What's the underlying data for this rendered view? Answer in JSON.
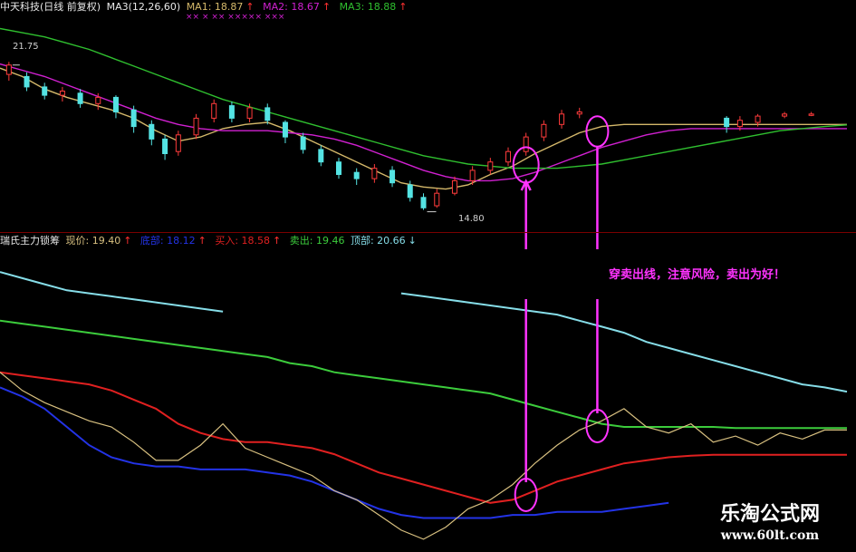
{
  "top_header": {
    "stock": "中天科技(日线 前复权)",
    "ma3_label": "MA3(12,26,60)",
    "ma1_label": "MA1: 18.87",
    "ma2_label": "MA2: 18.67",
    "ma3_value_label": "MA3: 18.88",
    "arrow_up": "↑",
    "markers": "×× × ×× ××××× ×××"
  },
  "bottom_header": {
    "indicator": "瑞氏主力锁筹",
    "price_label": "现价: 19.40",
    "bottom_label": "底部: 18.12",
    "buy_label": "买入: 18.58",
    "sell_label": "卖出: 19.46",
    "top_label": "顶部: 20.66",
    "arrow_up": "↑",
    "arrow_down": "↓"
  },
  "annotation": "穿卖出线，注意风险，卖出为好！",
  "price_high_label": "21.75",
  "price_low_label": "14.80",
  "watermark": {
    "title": "乐淘公式网",
    "url": "www.60lt.com"
  },
  "colors": {
    "background": "#000000",
    "ma1": "#d4b86a",
    "ma2": "#d020d0",
    "ma3": "#2fbf2f",
    "candle_up": "#ff3b3b",
    "candle_down": "#54e3e3",
    "top_line": "#86dde8",
    "sell_line": "#3ccc3c",
    "buy_line": "#e02020",
    "bottom_line": "#2333e6",
    "price_line": "#d8c080",
    "annotation": "#ff33ff"
  },
  "chart_data": [
    {
      "type": "line",
      "title": "中天科技(日线 前复权)",
      "x": [
        0,
        5,
        10,
        15,
        20,
        25,
        30,
        35,
        40,
        45,
        50,
        55,
        60,
        65,
        70,
        75,
        80,
        85,
        90,
        95,
        100,
        105,
        110,
        115,
        120,
        125,
        130,
        135,
        140,
        145,
        150,
        155,
        160,
        165,
        170,
        175,
        180,
        185,
        190
      ],
      "series": [
        {
          "name": "MA1",
          "values": [
            21.6,
            21.2,
            20.6,
            20.2,
            19.9,
            19.6,
            19.2,
            18.6,
            18.1,
            18.3,
            18.7,
            18.9,
            19.0,
            18.6,
            18.1,
            17.6,
            17.1,
            16.6,
            16.1,
            15.9,
            15.8,
            16.0,
            16.5,
            16.9,
            17.5,
            18.0,
            18.5,
            18.8,
            18.9,
            18.9,
            18.9,
            18.9,
            18.9,
            18.9,
            18.9,
            18.9,
            18.9,
            18.9,
            18.9
          ]
        },
        {
          "name": "MA2",
          "values": [
            21.8,
            21.5,
            21.2,
            20.8,
            20.4,
            20.0,
            19.6,
            19.2,
            18.9,
            18.7,
            18.6,
            18.6,
            18.6,
            18.5,
            18.4,
            18.2,
            17.9,
            17.5,
            17.1,
            16.7,
            16.4,
            16.2,
            16.2,
            16.3,
            16.6,
            17.0,
            17.4,
            17.8,
            18.1,
            18.4,
            18.6,
            18.7,
            18.7,
            18.7,
            18.7,
            18.7,
            18.7,
            18.7,
            18.7
          ]
        },
        {
          "name": "MA3",
          "values": [
            23.5,
            23.3,
            23.1,
            22.8,
            22.5,
            22.1,
            21.7,
            21.3,
            20.9,
            20.5,
            20.1,
            19.8,
            19.5,
            19.2,
            18.9,
            18.6,
            18.3,
            18.0,
            17.7,
            17.4,
            17.2,
            17.0,
            16.9,
            16.8,
            16.8,
            16.8,
            16.9,
            17.0,
            17.2,
            17.4,
            17.6,
            17.8,
            18.0,
            18.2,
            18.4,
            18.6,
            18.7,
            18.8,
            18.88
          ]
        }
      ],
      "candles": [
        {
          "x": 2,
          "o": 21.3,
          "c": 21.75,
          "h": 21.9,
          "l": 21.0
        },
        {
          "x": 6,
          "o": 21.2,
          "c": 20.7,
          "h": 21.4,
          "l": 20.5
        },
        {
          "x": 10,
          "o": 20.7,
          "c": 20.3,
          "h": 20.9,
          "l": 20.1
        },
        {
          "x": 14,
          "o": 20.3,
          "c": 20.5,
          "h": 20.7,
          "l": 20.0
        },
        {
          "x": 18,
          "o": 20.4,
          "c": 19.9,
          "h": 20.6,
          "l": 19.7
        },
        {
          "x": 22,
          "o": 19.9,
          "c": 20.2,
          "h": 20.4,
          "l": 19.6
        },
        {
          "x": 26,
          "o": 20.2,
          "c": 19.5,
          "h": 20.3,
          "l": 19.2
        },
        {
          "x": 30,
          "o": 19.6,
          "c": 18.8,
          "h": 19.8,
          "l": 18.5
        },
        {
          "x": 34,
          "o": 18.9,
          "c": 18.2,
          "h": 19.1,
          "l": 17.9
        },
        {
          "x": 37,
          "o": 18.2,
          "c": 17.5,
          "h": 18.4,
          "l": 17.2
        },
        {
          "x": 40,
          "o": 17.6,
          "c": 18.4,
          "h": 18.6,
          "l": 17.4
        },
        {
          "x": 44,
          "o": 18.4,
          "c": 19.2,
          "h": 19.4,
          "l": 18.2
        },
        {
          "x": 48,
          "o": 19.2,
          "c": 19.9,
          "h": 20.1,
          "l": 19.0
        },
        {
          "x": 52,
          "o": 19.8,
          "c": 19.2,
          "h": 20.0,
          "l": 19.0
        },
        {
          "x": 56,
          "o": 19.2,
          "c": 19.7,
          "h": 19.9,
          "l": 19.0
        },
        {
          "x": 60,
          "o": 19.7,
          "c": 19.1,
          "h": 19.9,
          "l": 18.9
        },
        {
          "x": 64,
          "o": 19.0,
          "c": 18.3,
          "h": 19.1,
          "l": 18.0
        },
        {
          "x": 68,
          "o": 18.3,
          "c": 17.7,
          "h": 18.5,
          "l": 17.5
        },
        {
          "x": 72,
          "o": 17.7,
          "c": 17.1,
          "h": 17.9,
          "l": 16.9
        },
        {
          "x": 76,
          "o": 17.1,
          "c": 16.5,
          "h": 17.3,
          "l": 16.3
        },
        {
          "x": 80,
          "o": 16.6,
          "c": 16.3,
          "h": 16.8,
          "l": 16.0
        },
        {
          "x": 84,
          "o": 16.3,
          "c": 16.8,
          "h": 17.0,
          "l": 16.1
        },
        {
          "x": 88,
          "o": 16.7,
          "c": 16.1,
          "h": 16.9,
          "l": 15.9
        },
        {
          "x": 92,
          "o": 16.0,
          "c": 15.4,
          "h": 16.2,
          "l": 15.2
        },
        {
          "x": 95,
          "o": 15.4,
          "c": 14.9,
          "h": 15.6,
          "l": 14.8
        },
        {
          "x": 98,
          "o": 15.0,
          "c": 15.6,
          "h": 15.8,
          "l": 14.9
        },
        {
          "x": 102,
          "o": 15.6,
          "c": 16.2,
          "h": 16.4,
          "l": 15.5
        },
        {
          "x": 106,
          "o": 16.2,
          "c": 16.7,
          "h": 16.9,
          "l": 16.0
        },
        {
          "x": 110,
          "o": 16.7,
          "c": 17.1,
          "h": 17.3,
          "l": 16.5
        },
        {
          "x": 114,
          "o": 17.1,
          "c": 17.6,
          "h": 17.8,
          "l": 16.9
        },
        {
          "x": 118,
          "o": 17.6,
          "c": 18.3,
          "h": 18.5,
          "l": 17.4
        },
        {
          "x": 122,
          "o": 18.3,
          "c": 18.9,
          "h": 19.1,
          "l": 18.1
        },
        {
          "x": 126,
          "o": 18.9,
          "c": 19.4,
          "h": 19.6,
          "l": 18.7
        },
        {
          "x": 130,
          "o": 19.4,
          "c": 19.5,
          "h": 19.7,
          "l": 19.2
        },
        {
          "x": 163,
          "o": 19.2,
          "c": 18.8,
          "h": 19.3,
          "l": 18.5
        },
        {
          "x": 166,
          "o": 18.8,
          "c": 19.1,
          "h": 19.3,
          "l": 18.6
        },
        {
          "x": 170,
          "o": 19.0,
          "c": 19.3,
          "h": 19.4,
          "l": 18.8
        },
        {
          "x": 176,
          "o": 19.3,
          "c": 19.4,
          "h": 19.5,
          "l": 19.2
        },
        {
          "x": 182,
          "o": 19.4,
          "c": 19.4,
          "h": 19.5,
          "l": 19.3
        }
      ],
      "ylim": [
        14.0,
        24.0
      ],
      "xlim": [
        0,
        190
      ],
      "annotations": [
        {
          "text": "21.75",
          "x": 2,
          "y": 21.75
        },
        {
          "text": "14.80",
          "x": 95,
          "y": 14.8
        }
      ]
    },
    {
      "type": "line",
      "title": "瑞氏主力锁筹",
      "x": [
        0,
        5,
        10,
        15,
        20,
        25,
        30,
        35,
        40,
        45,
        50,
        55,
        60,
        65,
        70,
        75,
        80,
        85,
        90,
        95,
        100,
        105,
        110,
        115,
        120,
        125,
        130,
        135,
        140,
        145,
        150,
        155,
        160,
        165,
        170,
        175,
        180,
        185,
        190
      ],
      "series": [
        {
          "name": "顶部",
          "values": [
            24.6,
            24.4,
            24.2,
            24.0,
            23.9,
            23.8,
            23.7,
            23.6,
            23.5,
            23.4,
            23.3,
            null,
            null,
            null,
            null,
            null,
            null,
            null,
            23.9,
            23.8,
            23.7,
            23.6,
            23.5,
            23.4,
            23.3,
            23.2,
            23.0,
            22.8,
            22.6,
            22.3,
            22.1,
            21.9,
            21.7,
            21.5,
            21.3,
            21.1,
            20.9,
            20.8,
            20.66
          ]
        },
        {
          "name": "卖出",
          "values": [
            23.0,
            22.9,
            22.8,
            22.7,
            22.6,
            22.5,
            22.4,
            22.3,
            22.2,
            22.1,
            22.0,
            21.9,
            21.8,
            21.6,
            21.5,
            21.3,
            21.2,
            21.1,
            21.0,
            20.9,
            20.8,
            20.7,
            20.6,
            20.4,
            20.2,
            20.0,
            19.8,
            19.6,
            19.5,
            19.5,
            19.5,
            19.5,
            19.5,
            19.46,
            19.46,
            19.46,
            19.46,
            19.46,
            19.46
          ]
        },
        {
          "name": "买入",
          "values": [
            21.3,
            21.2,
            21.1,
            21.0,
            20.9,
            20.7,
            20.4,
            20.1,
            19.6,
            19.3,
            19.1,
            19.0,
            19.0,
            18.9,
            18.8,
            18.6,
            18.3,
            18.0,
            17.8,
            17.6,
            17.4,
            17.2,
            17.0,
            17.1,
            17.4,
            17.7,
            17.9,
            18.1,
            18.3,
            18.4,
            18.5,
            18.55,
            18.58,
            18.58,
            18.58,
            18.58,
            18.58,
            18.58,
            18.58
          ]
        },
        {
          "name": "底部",
          "values": [
            20.8,
            20.5,
            20.1,
            19.5,
            18.9,
            18.5,
            18.3,
            18.2,
            18.2,
            18.1,
            18.1,
            18.1,
            18.0,
            17.9,
            17.7,
            17.4,
            17.1,
            16.8,
            16.6,
            16.5,
            16.5,
            16.5,
            16.5,
            16.6,
            16.6,
            16.7,
            16.7,
            16.7,
            16.8,
            16.9,
            17.0,
            null,
            null,
            null,
            null,
            null,
            null,
            null,
            null
          ]
        },
        {
          "name": "现价",
          "values": [
            21.3,
            20.7,
            20.3,
            20.0,
            19.7,
            19.5,
            19.0,
            18.4,
            18.4,
            18.9,
            19.6,
            18.8,
            18.5,
            18.2,
            17.9,
            17.4,
            17.1,
            16.6,
            16.1,
            15.8,
            16.2,
            16.8,
            17.1,
            17.6,
            18.3,
            18.9,
            19.4,
            19.7,
            20.1,
            19.5,
            19.3,
            19.6,
            19.0,
            19.2,
            18.9,
            19.3,
            19.1,
            19.4,
            19.4
          ]
        }
      ],
      "ylim": [
        15.5,
        25.5
      ],
      "xlim": [
        0,
        190
      ],
      "annotations": [
        {
          "text": "穿卖出线，注意风险，卖出为好！",
          "x": 139,
          "y": 24.2
        }
      ]
    }
  ]
}
